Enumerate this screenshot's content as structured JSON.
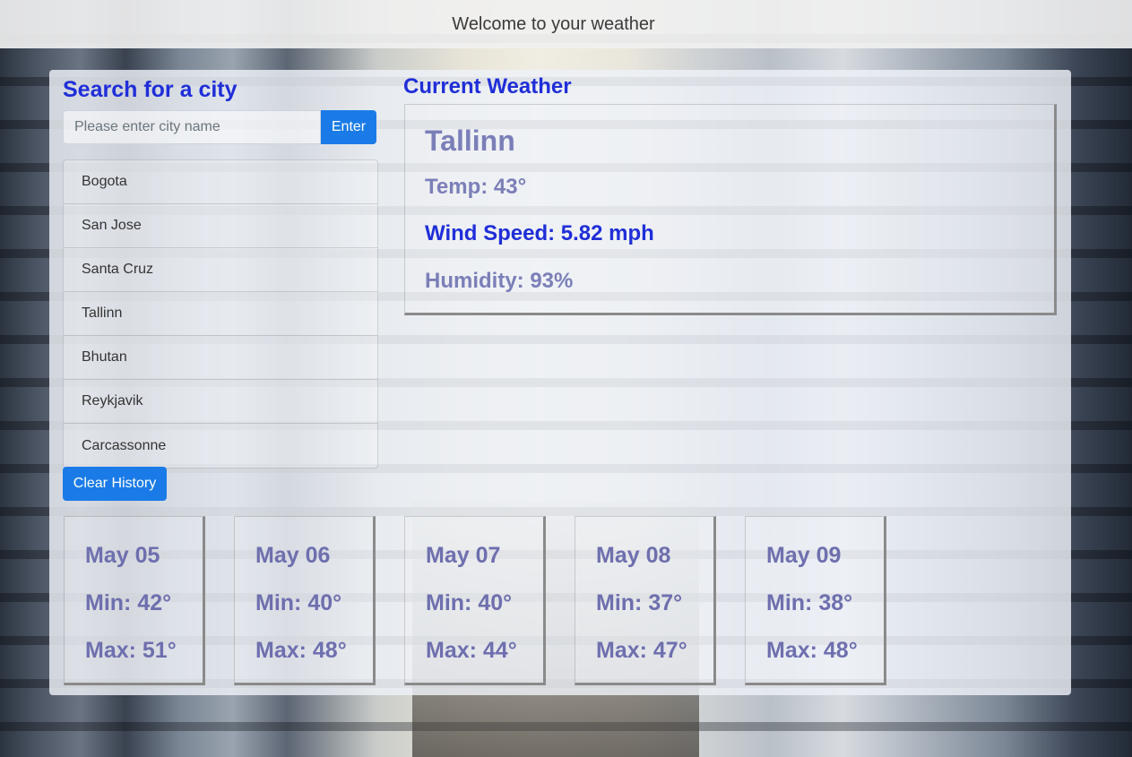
{
  "header": {
    "title": "Welcome to your weather"
  },
  "search": {
    "heading": "Search for a city",
    "placeholder": "Please enter city name",
    "value": "",
    "enter_label": "Enter"
  },
  "history": {
    "items": [
      "Bogota",
      "San Jose",
      "Santa Cruz",
      "Tallinn",
      "Bhutan",
      "Reykjavik",
      "Carcassonne"
    ],
    "clear_label": "Clear History"
  },
  "current": {
    "heading": "Current Weather",
    "city": "Tallinn",
    "temp": "Temp: 43°",
    "wind": "Wind Speed: 5.82 mph",
    "humidity": "Humidity: 93%"
  },
  "forecast": [
    {
      "date": "May 05",
      "min": "Min: 42°",
      "max": "Max: 51°"
    },
    {
      "date": "May 06",
      "min": "Min: 40°",
      "max": "Max: 48°"
    },
    {
      "date": "May 07",
      "min": "Min: 40°",
      "max": "Max: 44°"
    },
    {
      "date": "May 08",
      "min": "Min: 37°",
      "max": "Max: 47°"
    },
    {
      "date": "May 09",
      "min": "Min: 38°",
      "max": "Max: 48°"
    }
  ],
  "colors": {
    "accent_blue": "#1f2ed8",
    "button_blue": "#1a7be8",
    "muted_purple": "#7b7fb8"
  }
}
